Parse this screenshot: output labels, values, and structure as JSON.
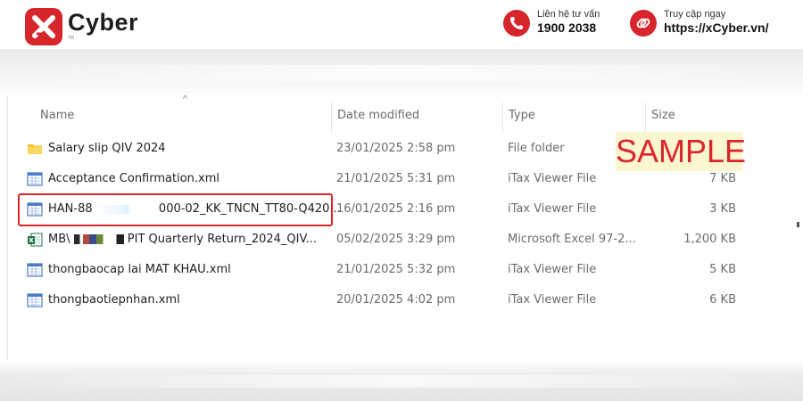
{
  "brand": {
    "name": "Cyber",
    "trademark": "TM",
    "accent_color": "#d7262b",
    "phone_label": "Liên hệ tư vấn",
    "phone_number": "1900 2038",
    "web_label": "Truy cập ngay",
    "web_url": "https://xCyber.vn/"
  },
  "explorer": {
    "columns": {
      "name": "Name",
      "date_modified": "Date modified",
      "type": "Type",
      "size": "Size"
    },
    "sort_indicator": "^",
    "files": [
      {
        "icon": "folder-icon",
        "name": "Salary slip QIV 2024",
        "date": "23/01/2025 2:58 pm",
        "type": "File folder",
        "size": ""
      },
      {
        "icon": "itax-file-icon",
        "name": "Acceptance Confirmation.xml",
        "date": "21/01/2025 5:31 pm",
        "type": "iTax Viewer File",
        "size": "7 KB"
      },
      {
        "icon": "itax-file-icon",
        "name_prefix": "HAN-88",
        "name_suffix": "000-02_KK_TNCN_TT80-Q420...",
        "date": "16/01/2025 2:16 pm",
        "type": "iTax Viewer File",
        "size": "3 KB",
        "highlighted": true
      },
      {
        "icon": "excel-file-icon",
        "name_prefix": "MB\\",
        "name_suffix": "PIT Quarterly Return_2024_QIV...",
        "date": "05/02/2025 3:29 pm",
        "type": "Microsoft Excel 97-2...",
        "size": "1,200 KB"
      },
      {
        "icon": "itax-file-icon",
        "name": "thongbaocap lai MAT KHAU.xml",
        "date": "21/01/2025 5:32 pm",
        "type": "iTax Viewer File",
        "size": "5 KB"
      },
      {
        "icon": "itax-file-icon",
        "name": "thongbaotiepnhan.xml",
        "date": "20/01/2025 4:02 pm",
        "type": "iTax Viewer File",
        "size": "6 KB"
      }
    ]
  },
  "watermark": {
    "text": "SAMPLE"
  }
}
